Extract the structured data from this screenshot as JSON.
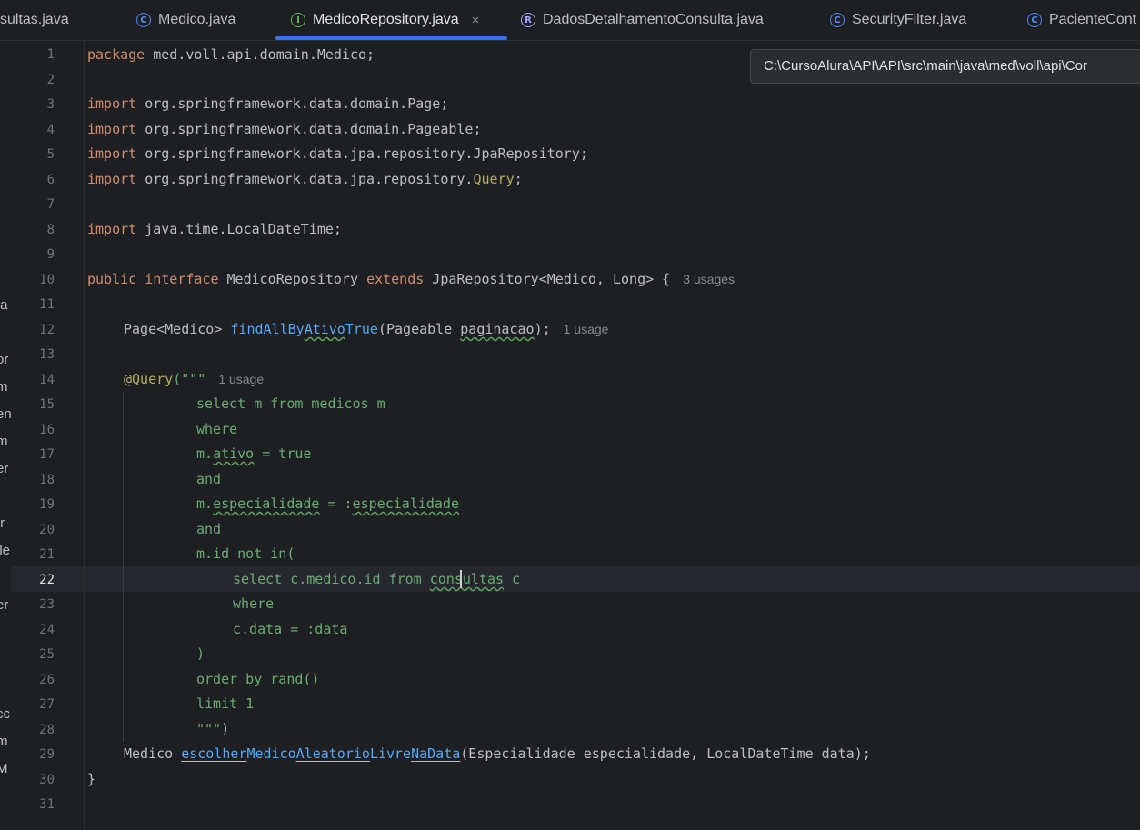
{
  "tabs": [
    {
      "label": "sultas.java",
      "icon": "none",
      "active": false
    },
    {
      "label": "Medico.java",
      "icon": "class-icon",
      "active": false
    },
    {
      "label": "MedicoRepository.java",
      "icon": "interface-icon",
      "active": true,
      "close": "×"
    },
    {
      "label": "DadosDetalhamentoConsulta.java",
      "icon": "record-icon",
      "active": false
    },
    {
      "label": "SecurityFilter.java",
      "icon": "class-icon",
      "active": false
    },
    {
      "label": "PacienteCont",
      "icon": "class-icon",
      "active": false
    }
  ],
  "tooltip": {
    "path": "C:\\CursoAlura\\API\\API\\src\\main\\java\\med\\voll\\api\\Cor"
  },
  "left_strip": [
    "ta",
    "or",
    "m",
    "en",
    "m",
    "er",
    "tr",
    "lle",
    "er",
    "cc",
    "m",
    "M"
  ],
  "line_numbers": [
    "1",
    "2",
    "3",
    "4",
    "5",
    "6",
    "7",
    "8",
    "9",
    "10",
    "11",
    "12",
    "13",
    "14",
    "15",
    "16",
    "17",
    "18",
    "19",
    "20",
    "21",
    "22",
    "23",
    "24",
    "25",
    "26",
    "27",
    "28",
    "29",
    "30",
    "31"
  ],
  "current_line": "22",
  "code": {
    "l1": {
      "kw": "package",
      "rest": " med.voll.api.domain.Medico;"
    },
    "l3": {
      "kw": "import",
      "rest": " org.springframework.data.domain.Page;"
    },
    "l4": {
      "kw": "import",
      "rest": " org.springframework.data.domain.Pageable;"
    },
    "l5": {
      "kw": "import",
      "rest": " org.springframework.data.jpa.repository.JpaRepository;"
    },
    "l6": {
      "kw": "import",
      "rest": " org.springframework.data.jpa.repository.",
      "ann": "Query",
      "end": ";"
    },
    "l8": {
      "kw": "import",
      "rest": " java.time.LocalDateTime;"
    },
    "l10": {
      "kw1": "public",
      "kw2": "interface",
      "name": " MedicoRepository ",
      "kw3": "extends",
      "rest": " JpaRepository<Medico, Long> {",
      "hint": "3 usages"
    },
    "l12": {
      "a": "Page<Medico> ",
      "fn1": "findAllBy",
      "fn2": "Ativo",
      "fn3": "True",
      "b": "(Pageable ",
      "param": "paginacao",
      "c": ");",
      "hint": "1 usage"
    },
    "l14": {
      "ann": "@Query",
      "str": "(\"\"\"",
      "hint": "1 usage"
    },
    "l15": "select m from medicos m",
    "l16": "where",
    "l17": {
      "a": "m.",
      "u": "ativo",
      "b": " = true"
    },
    "l18": "and",
    "l19": {
      "a": "m.",
      "u1": "especialidade",
      "b": " = :",
      "u2": "especialidade"
    },
    "l20": "and",
    "l21": "m.id not in(",
    "l22": {
      "a": "select c.medico.id from ",
      "u": "consultas",
      "b": " c"
    },
    "l23": "where",
    "l24": "c.data = :data",
    "l25": ")",
    "l26": "order by rand()",
    "l27": "limit 1",
    "l28": {
      "str": "\"\"\"",
      "end": ")"
    },
    "l29": {
      "a": "Medico ",
      "fn1": "escolher",
      "fn2": "Medico",
      "fn3": "Aleatorio",
      "fn4": "Livre",
      "fn5": "NaData",
      "b": "(Especialidade especialidade, LocalDateTime data);"
    },
    "l30": "}"
  },
  "colors": {
    "keyword": "#cf8e6d",
    "function": "#56a8f5",
    "annotation": "#b3ae60",
    "string": "#6aab73",
    "accent": "#3574f0"
  }
}
